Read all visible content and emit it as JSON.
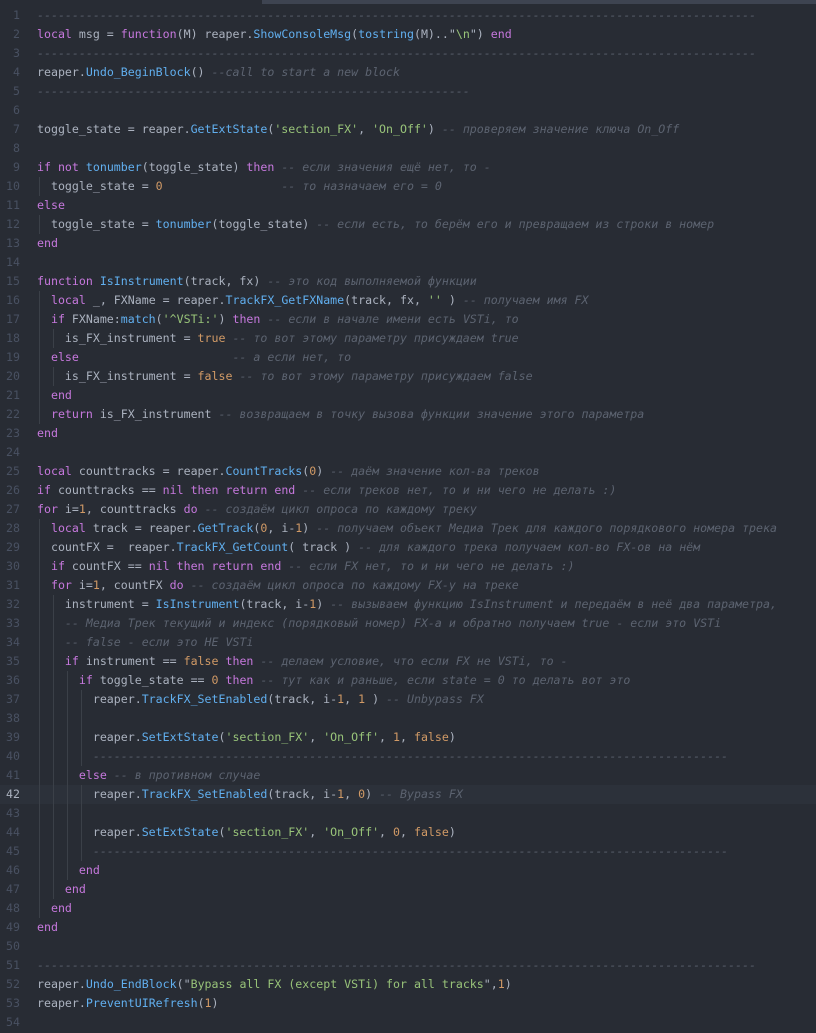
{
  "editor": {
    "active_line": 42,
    "colors": {
      "background": "#282c34",
      "keyword": "#c678dd",
      "function": "#61afef",
      "string": "#98c379",
      "number": "#d19a66",
      "comment": "#5c6370"
    },
    "lines": [
      {
        "n": "1",
        "indent": 0,
        "tokens": [
          [
            "c",
            "-------------------------------------------------------------------------------------------------------"
          ]
        ]
      },
      {
        "n": "2",
        "indent": 0,
        "tokens": [
          [
            "k",
            "local"
          ],
          [
            "v",
            " msg = "
          ],
          [
            "k",
            "function"
          ],
          [
            "v",
            "(M) reaper."
          ],
          [
            "f",
            "ShowConsoleMsg"
          ],
          [
            "v",
            "("
          ],
          [
            "f",
            "tostring"
          ],
          [
            "v",
            "(M)..\""
          ],
          [
            "s",
            "\\n"
          ],
          [
            "v",
            "\") "
          ],
          [
            "k",
            "end"
          ]
        ]
      },
      {
        "n": "3",
        "indent": 0,
        "tokens": [
          [
            "c",
            "-------------------------------------------------------------------------------------------------------"
          ]
        ]
      },
      {
        "n": "4",
        "indent": 0,
        "tokens": [
          [
            "v",
            "reaper."
          ],
          [
            "f",
            "Undo_BeginBlock"
          ],
          [
            "v",
            "() "
          ],
          [
            "c",
            "--call to start a new block"
          ]
        ]
      },
      {
        "n": "5",
        "indent": 0,
        "tokens": [
          [
            "c",
            "--------------------------------------------------------------"
          ]
        ]
      },
      {
        "n": "6",
        "indent": 0,
        "tokens": []
      },
      {
        "n": "7",
        "indent": 0,
        "tokens": [
          [
            "v",
            "toggle_state = reaper."
          ],
          [
            "f",
            "GetExtState"
          ],
          [
            "v",
            "("
          ],
          [
            "s",
            "'section_FX'"
          ],
          [
            "v",
            ", "
          ],
          [
            "s",
            "'On_Off'"
          ],
          [
            "v",
            ") "
          ],
          [
            "c",
            "-- проверяем значение ключа On_Off"
          ]
        ]
      },
      {
        "n": "8",
        "indent": 0,
        "tokens": []
      },
      {
        "n": "9",
        "indent": 0,
        "tokens": [
          [
            "k",
            "if not "
          ],
          [
            "f",
            "tonumber"
          ],
          [
            "v",
            "(toggle_state) "
          ],
          [
            "k",
            "then"
          ],
          [
            "v",
            " "
          ],
          [
            "c",
            "-- если значения ещё нет, то -"
          ]
        ]
      },
      {
        "n": "10",
        "indent": 1,
        "tokens": [
          [
            "v",
            "  toggle_state = "
          ],
          [
            "n",
            "0"
          ],
          [
            "v",
            "                 "
          ],
          [
            "c",
            "-- то назначаем его = 0"
          ]
        ]
      },
      {
        "n": "11",
        "indent": 0,
        "tokens": [
          [
            "k",
            "else"
          ]
        ]
      },
      {
        "n": "12",
        "indent": 1,
        "tokens": [
          [
            "v",
            "  toggle_state = "
          ],
          [
            "f",
            "tonumber"
          ],
          [
            "v",
            "(toggle_state) "
          ],
          [
            "c",
            "-- если есть, то берём его и превращаем из строки в номер"
          ]
        ]
      },
      {
        "n": "13",
        "indent": 0,
        "tokens": [
          [
            "k",
            "end"
          ]
        ]
      },
      {
        "n": "14",
        "indent": 0,
        "tokens": []
      },
      {
        "n": "15",
        "indent": 0,
        "tokens": [
          [
            "k",
            "function "
          ],
          [
            "f",
            "IsInstrument"
          ],
          [
            "v",
            "(track, fx) "
          ],
          [
            "c",
            "-- это код выполняемой функции"
          ]
        ]
      },
      {
        "n": "16",
        "indent": 1,
        "tokens": [
          [
            "k",
            "  local"
          ],
          [
            "v",
            " _, FXName = reaper."
          ],
          [
            "f",
            "TrackFX_GetFXName"
          ],
          [
            "v",
            "(track, fx, "
          ],
          [
            "s",
            "''"
          ],
          [
            "v",
            " ) "
          ],
          [
            "c",
            "-- получаем имя FX"
          ]
        ]
      },
      {
        "n": "17",
        "indent": 1,
        "tokens": [
          [
            "k",
            "  if"
          ],
          [
            "v",
            " FXName:"
          ],
          [
            "f",
            "match"
          ],
          [
            "v",
            "("
          ],
          [
            "s",
            "'^VSTi:'"
          ],
          [
            "v",
            ") "
          ],
          [
            "k",
            "then"
          ],
          [
            "v",
            " "
          ],
          [
            "c",
            "-- если в начале имени есть VSTi, то"
          ]
        ]
      },
      {
        "n": "18",
        "indent": 2,
        "tokens": [
          [
            "v",
            "    is_FX_instrument = "
          ],
          [
            "n",
            "true"
          ],
          [
            "v",
            " "
          ],
          [
            "c",
            "-- то вот этому параметру присуждаем true"
          ]
        ]
      },
      {
        "n": "19",
        "indent": 1,
        "tokens": [
          [
            "k",
            "  else"
          ],
          [
            "v",
            "                      "
          ],
          [
            "c",
            "-- а если нет, то"
          ]
        ]
      },
      {
        "n": "20",
        "indent": 2,
        "tokens": [
          [
            "v",
            "    is_FX_instrument = "
          ],
          [
            "n",
            "false"
          ],
          [
            "v",
            " "
          ],
          [
            "c",
            "-- то вот этому параметру присуждаем false"
          ]
        ]
      },
      {
        "n": "21",
        "indent": 1,
        "tokens": [
          [
            "k",
            "  end"
          ]
        ]
      },
      {
        "n": "22",
        "indent": 1,
        "tokens": [
          [
            "k",
            "  return"
          ],
          [
            "v",
            " is_FX_instrument "
          ],
          [
            "c",
            "-- возвращаем в точку вызова функции значение этого параметра"
          ]
        ]
      },
      {
        "n": "23",
        "indent": 0,
        "tokens": [
          [
            "k",
            "end"
          ]
        ]
      },
      {
        "n": "24",
        "indent": 0,
        "tokens": []
      },
      {
        "n": "25",
        "indent": 0,
        "tokens": [
          [
            "k",
            "local"
          ],
          [
            "v",
            " counttracks = reaper."
          ],
          [
            "f",
            "CountTracks"
          ],
          [
            "v",
            "("
          ],
          [
            "n",
            "0"
          ],
          [
            "v",
            ") "
          ],
          [
            "c",
            "-- даём значение кол-ва треков"
          ]
        ]
      },
      {
        "n": "26",
        "indent": 0,
        "tokens": [
          [
            "k",
            "if"
          ],
          [
            "v",
            " counttracks == "
          ],
          [
            "k",
            "nil then return end"
          ],
          [
            "v",
            " "
          ],
          [
            "c",
            "-- если треков нет, то и ни чего не делать :)"
          ]
        ]
      },
      {
        "n": "27",
        "indent": 0,
        "tokens": [
          [
            "k",
            "for"
          ],
          [
            "v",
            " i="
          ],
          [
            "n",
            "1"
          ],
          [
            "v",
            ", counttracks "
          ],
          [
            "k",
            "do"
          ],
          [
            "v",
            " "
          ],
          [
            "c",
            "-- создаём цикл опроса по каждому треку"
          ]
        ]
      },
      {
        "n": "28",
        "indent": 1,
        "tokens": [
          [
            "k",
            "  local"
          ],
          [
            "v",
            " track = reaper."
          ],
          [
            "f",
            "GetTrack"
          ],
          [
            "v",
            "("
          ],
          [
            "n",
            "0"
          ],
          [
            "v",
            ", i-"
          ],
          [
            "n",
            "1"
          ],
          [
            "v",
            ") "
          ],
          [
            "c",
            "-- получаем объект Медиа Трек для каждого порядкового номера трека"
          ]
        ]
      },
      {
        "n": "29",
        "indent": 1,
        "tokens": [
          [
            "v",
            "  countFX =  reaper."
          ],
          [
            "f",
            "TrackFX_GetCount"
          ],
          [
            "v",
            "( track ) "
          ],
          [
            "c",
            "-- для каждого трека получаем кол-во FX-ов на нём"
          ]
        ]
      },
      {
        "n": "30",
        "indent": 1,
        "tokens": [
          [
            "k",
            "  if"
          ],
          [
            "v",
            " countFX == "
          ],
          [
            "k",
            "nil then return end"
          ],
          [
            "v",
            " "
          ],
          [
            "c",
            "-- если FX нет, то и ни чего не делать :)"
          ]
        ]
      },
      {
        "n": "31",
        "indent": 1,
        "tokens": [
          [
            "k",
            "  for"
          ],
          [
            "v",
            " i="
          ],
          [
            "n",
            "1"
          ],
          [
            "v",
            ", countFX "
          ],
          [
            "k",
            "do"
          ],
          [
            "v",
            " "
          ],
          [
            "c",
            "-- создаём цикл опроса по каждому FX-у на треке"
          ]
        ]
      },
      {
        "n": "32",
        "indent": 2,
        "tokens": [
          [
            "v",
            "    instrument = "
          ],
          [
            "f",
            "IsInstrument"
          ],
          [
            "v",
            "(track, i-"
          ],
          [
            "n",
            "1"
          ],
          [
            "v",
            ") "
          ],
          [
            "c",
            "-- вызываем функцию IsInstrument и передаём в неё два параметра,"
          ]
        ]
      },
      {
        "n": "33",
        "indent": 2,
        "tokens": [
          [
            "c",
            "    -- Медиа Трек текущий и индекс (порядковый номер) FX-а и обратно получаем true - если это VSTi"
          ]
        ]
      },
      {
        "n": "34",
        "indent": 2,
        "tokens": [
          [
            "c",
            "    -- false - если это НЕ VSTi"
          ]
        ]
      },
      {
        "n": "35",
        "indent": 2,
        "tokens": [
          [
            "k",
            "    if"
          ],
          [
            "v",
            " instrument == "
          ],
          [
            "n",
            "false"
          ],
          [
            "k",
            " then"
          ],
          [
            "v",
            " "
          ],
          [
            "c",
            "-- делаем условие, что если FX не VSTi, то -"
          ]
        ]
      },
      {
        "n": "36",
        "indent": 3,
        "tokens": [
          [
            "k",
            "      if"
          ],
          [
            "v",
            " toggle_state == "
          ],
          [
            "n",
            "0"
          ],
          [
            "k",
            " then"
          ],
          [
            "v",
            " "
          ],
          [
            "c",
            "-- тут как и раньше, если state = 0 то делать вот это"
          ]
        ]
      },
      {
        "n": "37",
        "indent": 4,
        "tokens": [
          [
            "v",
            "        reaper."
          ],
          [
            "f",
            "TrackFX_SetEnabled"
          ],
          [
            "v",
            "(track, i-"
          ],
          [
            "n",
            "1"
          ],
          [
            "v",
            ", "
          ],
          [
            "n",
            "1"
          ],
          [
            "v",
            " ) "
          ],
          [
            "c",
            "-- Unbypass FX"
          ]
        ]
      },
      {
        "n": "38",
        "indent": 4,
        "tokens": []
      },
      {
        "n": "39",
        "indent": 4,
        "tokens": [
          [
            "v",
            "        reaper."
          ],
          [
            "f",
            "SetExtState"
          ],
          [
            "v",
            "("
          ],
          [
            "s",
            "'section_FX'"
          ],
          [
            "v",
            ", "
          ],
          [
            "s",
            "'On_Off'"
          ],
          [
            "v",
            ", "
          ],
          [
            "n",
            "1"
          ],
          [
            "v",
            ", "
          ],
          [
            "n",
            "false"
          ],
          [
            "v",
            ")"
          ]
        ]
      },
      {
        "n": "40",
        "indent": 4,
        "tokens": [
          [
            "c",
            "        -------------------------------------------------------------------------------------------"
          ]
        ]
      },
      {
        "n": "41",
        "indent": 3,
        "tokens": [
          [
            "k",
            "      else"
          ],
          [
            "v",
            " "
          ],
          [
            "c",
            "-- в противном случае"
          ]
        ]
      },
      {
        "n": "42",
        "indent": 4,
        "tokens": [
          [
            "v",
            "        reaper."
          ],
          [
            "f",
            "TrackFX_SetEnabled"
          ],
          [
            "v",
            "(track, i-"
          ],
          [
            "n",
            "1"
          ],
          [
            "v",
            ", "
          ],
          [
            "n",
            "0"
          ],
          [
            "v",
            ") "
          ],
          [
            "c",
            "-- Bypass FX"
          ]
        ]
      },
      {
        "n": "43",
        "indent": 4,
        "tokens": []
      },
      {
        "n": "44",
        "indent": 4,
        "tokens": [
          [
            "v",
            "        reaper."
          ],
          [
            "f",
            "SetExtState"
          ],
          [
            "v",
            "("
          ],
          [
            "s",
            "'section_FX'"
          ],
          [
            "v",
            ", "
          ],
          [
            "s",
            "'On_Off'"
          ],
          [
            "v",
            ", "
          ],
          [
            "n",
            "0"
          ],
          [
            "v",
            ", "
          ],
          [
            "n",
            "false"
          ],
          [
            "v",
            ")"
          ]
        ]
      },
      {
        "n": "45",
        "indent": 4,
        "tokens": [
          [
            "c",
            "        -------------------------------------------------------------------------------------------"
          ]
        ]
      },
      {
        "n": "46",
        "indent": 3,
        "tokens": [
          [
            "k",
            "      end"
          ]
        ]
      },
      {
        "n": "47",
        "indent": 2,
        "tokens": [
          [
            "k",
            "    end"
          ]
        ]
      },
      {
        "n": "48",
        "indent": 1,
        "tokens": [
          [
            "k",
            "  end"
          ]
        ]
      },
      {
        "n": "49",
        "indent": 0,
        "tokens": [
          [
            "k",
            "end"
          ]
        ]
      },
      {
        "n": "50",
        "indent": 0,
        "tokens": []
      },
      {
        "n": "51",
        "indent": 0,
        "tokens": [
          [
            "c",
            "-------------------------------------------------------------------------------------------------------"
          ]
        ]
      },
      {
        "n": "52",
        "indent": 0,
        "tokens": [
          [
            "v",
            "reaper."
          ],
          [
            "f",
            "Undo_EndBlock"
          ],
          [
            "v",
            "(\""
          ],
          [
            "s",
            "Bypass all FX (except VSTi) for all tracks"
          ],
          [
            "v",
            "\","
          ],
          [
            "n",
            "1"
          ],
          [
            "v",
            ")"
          ]
        ]
      },
      {
        "n": "53",
        "indent": 0,
        "tokens": [
          [
            "v",
            "reaper."
          ],
          [
            "f",
            "PreventUIRefresh"
          ],
          [
            "v",
            "("
          ],
          [
            "n",
            "1"
          ],
          [
            "v",
            ")"
          ]
        ]
      },
      {
        "n": "54",
        "indent": 0,
        "tokens": []
      }
    ]
  }
}
